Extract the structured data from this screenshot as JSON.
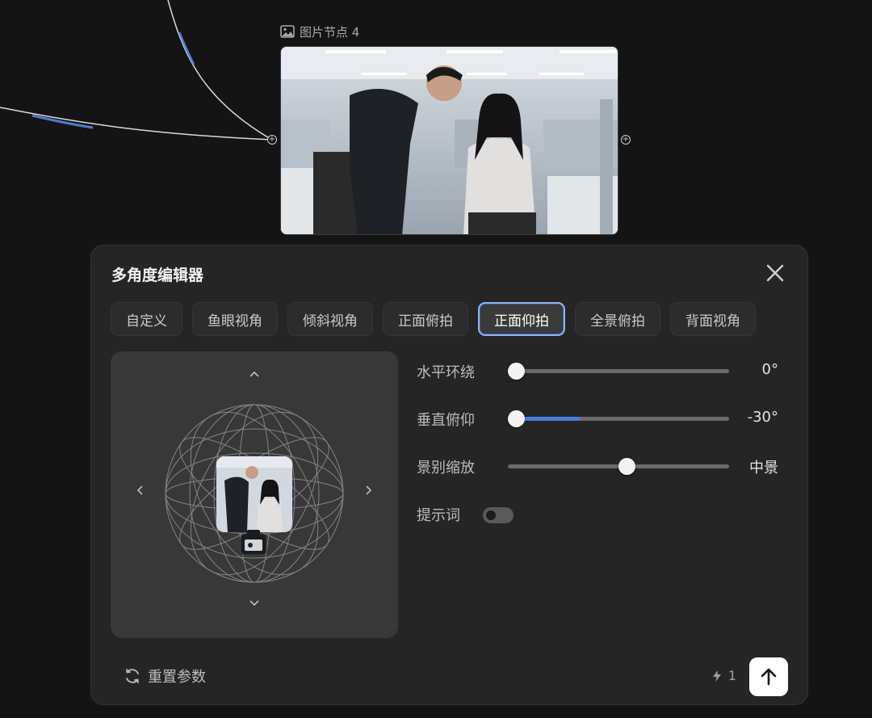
{
  "node": {
    "title": "图片节点 4",
    "image_icon": "image-icon"
  },
  "editor": {
    "title": "多角度编辑器",
    "close_icon": "close-icon",
    "tabs": [
      {
        "label": "自定义",
        "active": false
      },
      {
        "label": "鱼眼视角",
        "active": false
      },
      {
        "label": "倾斜视角",
        "active": false
      },
      {
        "label": "正面俯拍",
        "active": false
      },
      {
        "label": "正面仰拍",
        "active": true
      },
      {
        "label": "全景俯拍",
        "active": false
      },
      {
        "label": "背面视角",
        "active": false
      }
    ],
    "controls": {
      "horizontal": {
        "label": "水平环绕",
        "value": "0°",
        "fraction": 0.0
      },
      "vertical": {
        "label": "垂直俯仰",
        "value": "-30°",
        "fraction": 0.0,
        "fill_fraction": 0.33
      },
      "shot": {
        "label": "景别缩放",
        "value": "中景",
        "fraction": 0.5
      },
      "prompt": {
        "label": "提示词",
        "enabled": false
      }
    },
    "footer": {
      "reset_label": "重置参数",
      "credits": "1",
      "credits_icon": "lightning-icon",
      "send_icon": "arrow-up-icon"
    }
  },
  "colors": {
    "accent": "#4a7be0",
    "active_tab_border": "#8fb2f4",
    "wire": "#e8e8e8",
    "wire_glow": "#5d8de8"
  }
}
